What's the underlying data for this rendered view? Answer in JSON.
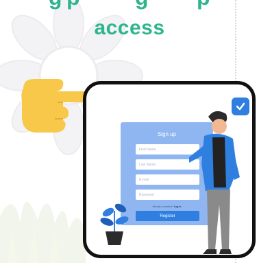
{
  "header": {
    "headline_fragments": [
      "g",
      "p",
      "g",
      "p"
    ],
    "subheadline": "access"
  },
  "form": {
    "title": "Sign up",
    "fields": [
      {
        "placeholder": "First Name"
      },
      {
        "placeholder": "Last Name"
      },
      {
        "placeholder": "E-mail"
      },
      {
        "placeholder": "Password"
      }
    ],
    "signin_prefix": "Already a member?",
    "signin_link": "Log in",
    "register_label": "Register"
  },
  "colors": {
    "accent_green": "#2fb58e",
    "card_blue": "#8fb6f0",
    "button_blue": "#2f7fe0",
    "hand_yellow": "#f7c84a"
  },
  "icons": [
    "pointing-hand-icon",
    "check-badge-icon"
  ]
}
